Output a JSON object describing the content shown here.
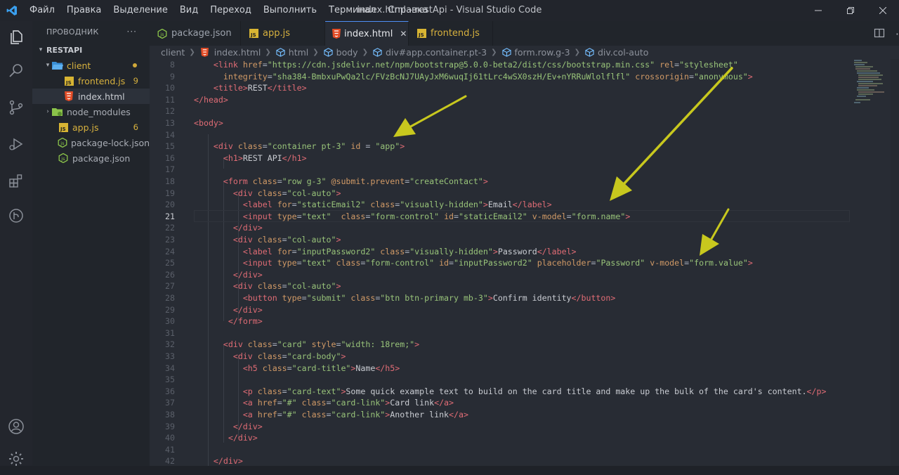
{
  "titlebar": {
    "menu": [
      "Файл",
      "Правка",
      "Выделение",
      "Вид",
      "Переход",
      "Выполнить",
      "Терминал",
      "Справка"
    ],
    "window_title": "index.html - restApi - Visual Studio Code"
  },
  "sidebar": {
    "header": "ПРОВОДНИК",
    "root": "RESTAPI",
    "items": [
      {
        "label": "client",
        "badge": ""
      },
      {
        "label": "frontend.js",
        "badge": "9"
      },
      {
        "label": "index.html",
        "badge": ""
      },
      {
        "label": "node_modules",
        "badge": ""
      },
      {
        "label": "app.js",
        "badge": "6"
      },
      {
        "label": "package-lock.json",
        "badge": ""
      },
      {
        "label": "package.json",
        "badge": ""
      }
    ]
  },
  "tabs": [
    {
      "label": "package.json"
    },
    {
      "label": "app.js"
    },
    {
      "label": "index.html"
    },
    {
      "label": "frontend.js"
    }
  ],
  "breadcrumb": [
    "client",
    "index.html",
    "html",
    "body",
    "div#app.container.pt-3",
    "form.row.g-3",
    "div.col-auto"
  ],
  "editor": {
    "current_line": 21,
    "line_numbers": [
      "8",
      "9",
      "10",
      "11",
      "12",
      "13",
      "14",
      "15",
      "16",
      "17",
      "18",
      "19",
      "20",
      "21",
      "22",
      "23",
      "24",
      "25",
      "26",
      "27",
      "28",
      "29",
      "30",
      "31",
      "32",
      "33",
      "34",
      "35",
      "36",
      "37",
      "38",
      "39",
      "40",
      "41",
      "42"
    ]
  },
  "colors": {
    "accent": "#4f8ff7",
    "tag": "#e06c75",
    "attribute": "#d19a66",
    "string": "#98c379",
    "arrow": "#c8c81e"
  }
}
